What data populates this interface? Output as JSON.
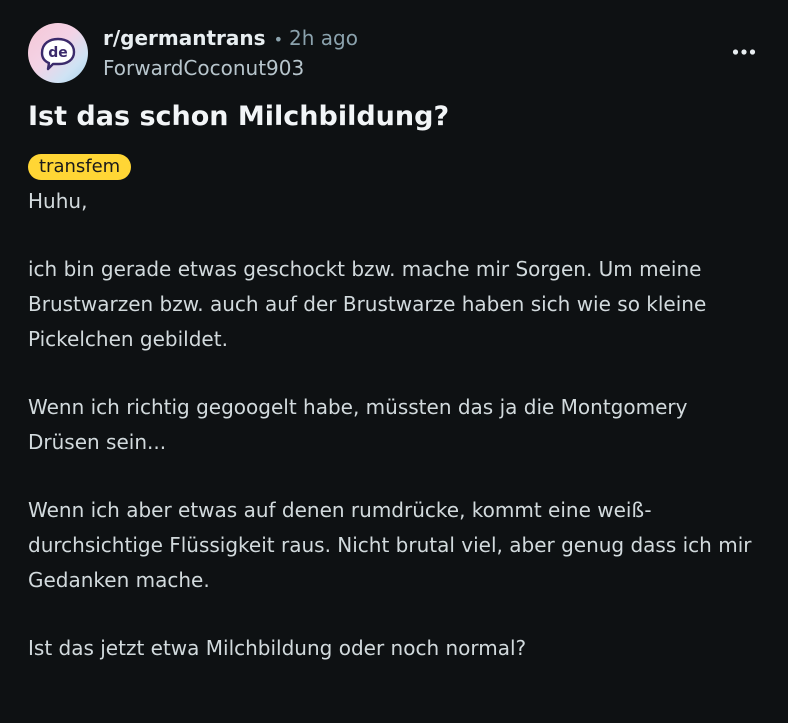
{
  "post": {
    "subreddit": "r/germantrans",
    "separator": "•",
    "time": "2h ago",
    "author": "ForwardCoconut903",
    "title": "Ist das schon Milchbildung?",
    "flair": "transfem",
    "paragraphs": [
      "Huhu,",
      "ich bin gerade etwas geschockt bzw. mache mir Sorgen. Um meine Brustwarzen bzw. auch auf der Brustwarze haben sich wie so kleine Pickelchen gebildet.",
      "Wenn ich richtig gegoogelt habe, müssten das ja die Montgomery Drüsen sein...",
      "Wenn ich aber etwas auf denen rumdrücke, kommt eine weiß-durchsichtige Flüssigkeit raus. Nicht brutal viel, aber genug dass ich mir Gedanken mache.",
      "Ist das jetzt etwa Milchbildung oder noch normal?"
    ]
  },
  "avatar": {
    "text": "de",
    "icon": "subreddit-avatar"
  },
  "icons": {
    "more": "more-options-icon"
  },
  "colors": {
    "background": "#0e1113",
    "flair": "#ffd635",
    "text": "#d2dadd"
  }
}
